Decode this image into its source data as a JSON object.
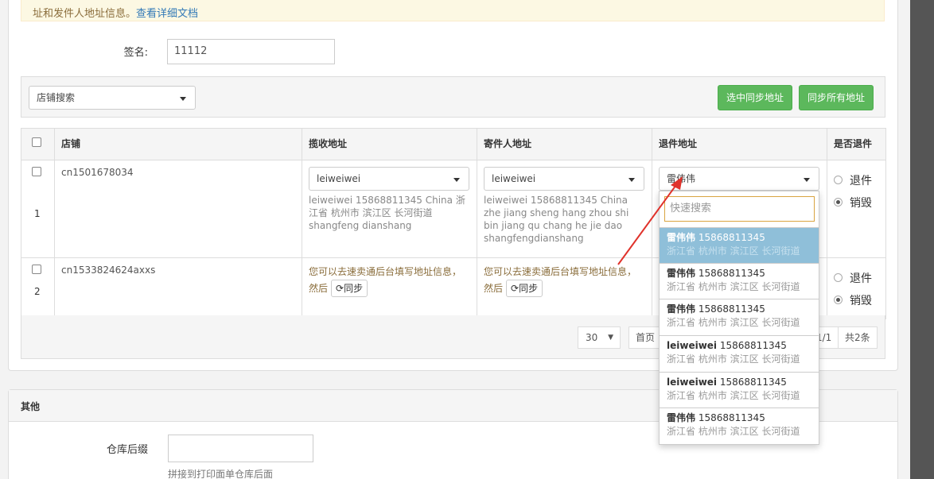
{
  "notice": {
    "text": "址和发件人地址信息。",
    "link": "查看详细文档"
  },
  "signature": {
    "label": "签名:",
    "value": "11112"
  },
  "toolbar": {
    "shop_search": "店铺搜索",
    "sync_selected": "选中同步地址",
    "sync_all": "同步所有地址"
  },
  "table": {
    "headers": [
      "店铺",
      "揽收地址",
      "寄件人地址",
      "退件地址",
      "是否退件"
    ],
    "rows": [
      {
        "num": "1",
        "shop": "cn1501678034",
        "pickup_select": "leiweiwei",
        "pickup_text": "leiweiwei 15868811345 China 浙江省 杭州市 滨江区 长河街道 shangfeng dianshang",
        "sender_select": "leiweiwei",
        "sender_text": "leiweiwei 15868811345 China zhe jiang sheng hang zhou shi bin jiang qu chang he jie dao shangfengdianshang",
        "return_select": "雷伟伟",
        "radio_return": "退件",
        "radio_destroy": "销毁"
      },
      {
        "num": "2",
        "shop": "cn1533824624axxs",
        "pickup_warn": "您可以去速卖通后台填写地址信息，然后",
        "sender_warn": "您可以去速卖通后台填写地址信息，然后",
        "sync_label": "同步",
        "radio_return": "退件",
        "radio_destroy": "销毁"
      }
    ]
  },
  "pagination": {
    "page_size": "30",
    "first": "首页",
    "page_info": "1/1",
    "total": "共2条"
  },
  "dropdown": {
    "search_placeholder": "快速搜索",
    "items": [
      {
        "name": "雷伟伟",
        "phone": "15868811345",
        "addr": "浙江省 杭州市 滨江区 长河街道"
      },
      {
        "name": "雷伟伟",
        "phone": "15868811345",
        "addr": "浙江省 杭州市 滨江区 长河街道"
      },
      {
        "name": "雷伟伟",
        "phone": "15868811345",
        "addr": "浙江省 杭州市 滨江区 长河街道"
      },
      {
        "name": "leiweiwei",
        "phone": "15868811345",
        "addr": "浙江省 杭州市 滨江区 长河街道"
      },
      {
        "name": "leiweiwei",
        "phone": "15868811345",
        "addr": "浙江省 杭州市 滨江区 长河街道"
      },
      {
        "name": "雷伟伟",
        "phone": "15868811345",
        "addr": "浙江省 杭州市 滨江区 长河街道"
      }
    ]
  },
  "other_section": {
    "title": "其他",
    "warehouse_label": "仓库后缀",
    "warehouse_help": "拼接到打印面单仓库后面"
  },
  "colors": {
    "green": "#5cb85c",
    "highlight": "#8fbfd9",
    "warning": "#8a6d3b",
    "arrow": "#e0322b"
  }
}
